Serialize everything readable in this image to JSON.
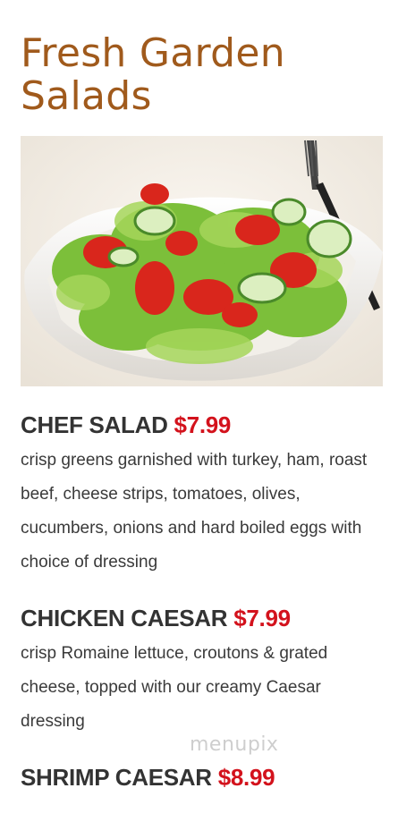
{
  "section": {
    "title": "Fresh Garden Salads"
  },
  "hero_image": {
    "description_icon": "salad-bowl-photo"
  },
  "items": [
    {
      "name": "CHEF SALAD",
      "price": "$7.99",
      "description": "crisp greens garnished with turkey, ham, roast beef, cheese strips, tomatoes, olives, cucumbers, onions and hard boiled eggs with choice of dressing"
    },
    {
      "name": "CHICKEN CAESAR",
      "price": "$7.99",
      "description": "crisp Romaine lettuce, croutons & grated cheese, topped with our creamy Caesar dressing"
    },
    {
      "name": "SHRIMP CAESAR",
      "price": "$8.99",
      "description": ""
    }
  ],
  "watermark": "menupix",
  "colors": {
    "title": "#a05a1c",
    "price": "#d3121c",
    "text": "#3a3a3a"
  }
}
